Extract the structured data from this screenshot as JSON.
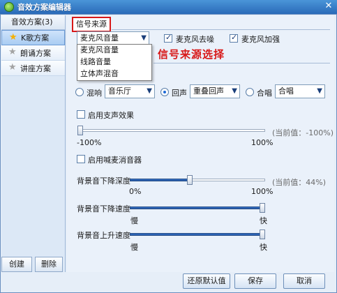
{
  "window": {
    "title": "音效方案编辑器"
  },
  "sidebar": {
    "header": "音效方案(3)",
    "items": [
      {
        "label": "K歌方案",
        "icon": "gold-star-icon",
        "selected": true
      },
      {
        "label": "朗诵方案",
        "icon": "grey-star-icon",
        "selected": false
      },
      {
        "label": "讲座方案",
        "icon": "grey-star-icon",
        "selected": false
      }
    ],
    "create_label": "创建",
    "delete_label": "删除"
  },
  "main": {
    "section_title": "信号来源",
    "signal_source": {
      "selected": "麦克风音量",
      "options": [
        "麦克风音量",
        "线路音量",
        "立体声混音"
      ]
    },
    "mic_denoise_label": "麦克风去噪",
    "mic_denoise_checked": true,
    "mic_boost_label": "麦克风加强",
    "mic_boost_checked": true,
    "annotation": "信号来源选择",
    "effects": {
      "reverb_label": "混响",
      "reverb_value": "音乐厅",
      "echo_label": "回声",
      "echo_value": "重叠回声",
      "chorus_label": "合唱",
      "chorus_value": "合唱",
      "selected": "echo"
    },
    "rumble": {
      "label": "启用支声效果",
      "checked": false,
      "current_text": "(当前值：-100%)",
      "min_label": "-100%",
      "max_label": "100%",
      "value_percent": -100
    },
    "anti_howl": {
      "label": "启用喊麦消音器",
      "checked": false
    },
    "bg_lower_depth": {
      "label": "背景音下降深度",
      "current_text": "(当前值：44%)",
      "min_label": "0%",
      "max_label": "100%",
      "value_percent": 44
    },
    "bg_lower_speed": {
      "label": "背景音下降速度",
      "slow_label": "慢",
      "fast_label": "快",
      "value_percent": 100
    },
    "bg_rise_speed": {
      "label": "背景音上升速度",
      "slow_label": "慢",
      "fast_label": "快",
      "value_percent": 100
    }
  },
  "footer": {
    "restore_label": "还原默认值",
    "save_label": "保存",
    "cancel_label": "取消"
  },
  "colors": {
    "accent_red": "#d81818",
    "title_blue": "#2a6ab8",
    "slider_fill": "#1d4f9e"
  }
}
